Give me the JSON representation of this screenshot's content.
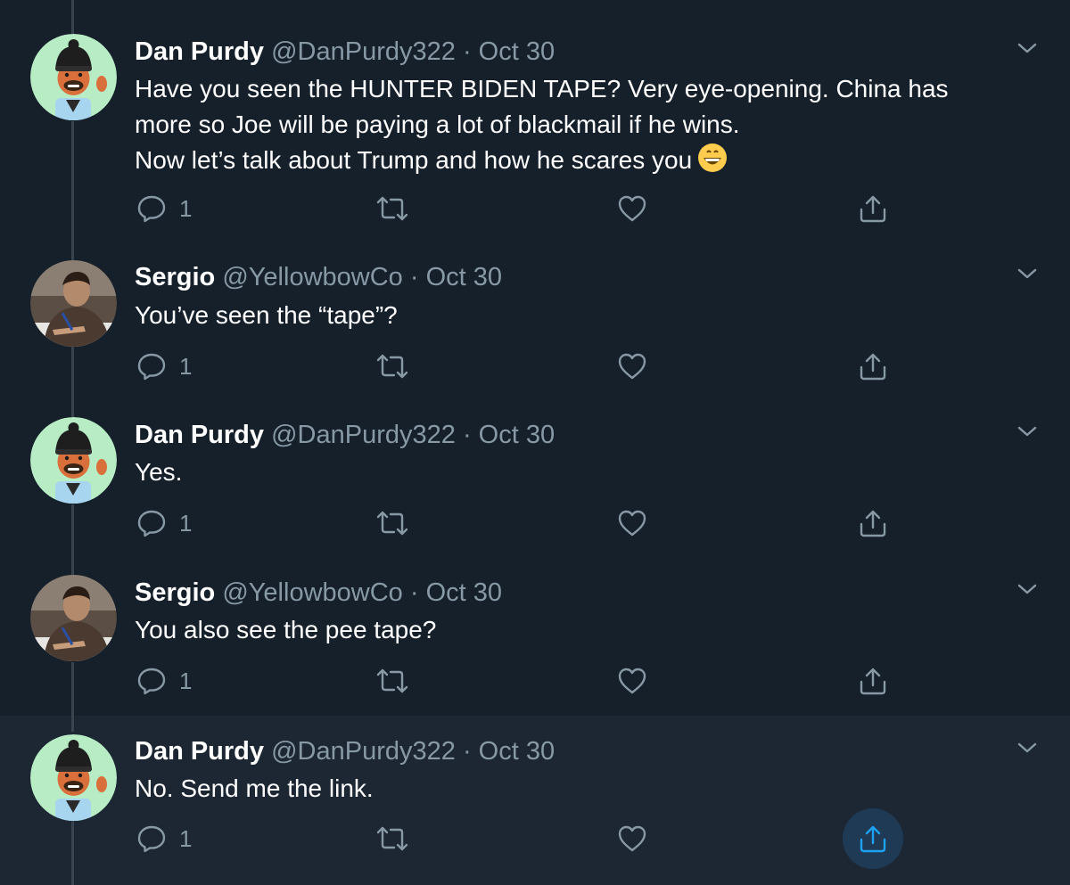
{
  "colors": {
    "background": "#15202b",
    "highlight_background": "#1c2733",
    "muted_text": "#8899a6",
    "accent": "#1da1f2",
    "thread_line": "#38444d"
  },
  "tweets": [
    {
      "name": "Dan Purdy",
      "handle": "@DanPurdy322",
      "separator": "·",
      "date": "Oct 30",
      "avatar": "memoji-avatar",
      "lines": [
        "Have you seen the HUNTER BIDEN TAPE? Very eye-opening. China has",
        "more so Joe will be paying a lot of blackmail if he wins.",
        "Now let’s talk about Trump and how he scares you"
      ],
      "emoji": "grinning-face-emoji",
      "reply_count": "1"
    },
    {
      "name": "Sergio",
      "handle": "@YellowbowCo",
      "separator": "·",
      "date": "Oct 30",
      "avatar": "photo-avatar",
      "lines": [
        "You’ve seen the “tape”?"
      ],
      "reply_count": "1"
    },
    {
      "name": "Dan Purdy",
      "handle": "@DanPurdy322",
      "separator": "·",
      "date": "Oct 30",
      "avatar": "memoji-avatar",
      "lines": [
        "Yes."
      ],
      "reply_count": "1"
    },
    {
      "name": "Sergio",
      "handle": "@YellowbowCo",
      "separator": "·",
      "date": "Oct 30",
      "avatar": "photo-avatar",
      "lines": [
        "You also see the pee tape?"
      ],
      "reply_count": "1"
    },
    {
      "name": "Dan Purdy",
      "handle": "@DanPurdy322",
      "separator": "·",
      "date": "Oct 30",
      "avatar": "memoji-avatar",
      "lines": [
        "No. Send me the link."
      ],
      "reply_count": "1",
      "share_hovered": true
    }
  ],
  "icons": {
    "reply": "reply-icon",
    "retweet": "retweet-icon",
    "like": "heart-icon",
    "share": "share-icon",
    "more": "chevron-down-icon"
  }
}
